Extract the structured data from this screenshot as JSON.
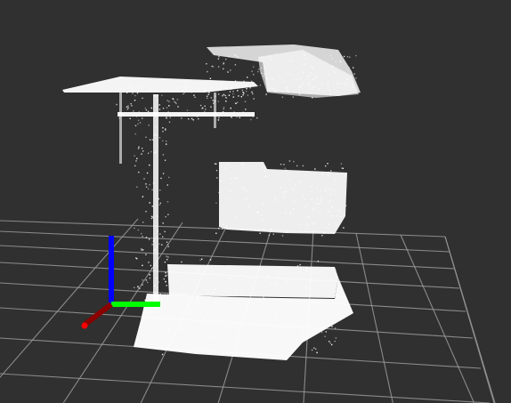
{
  "viewport": {
    "background_color": "#303030",
    "grid_color": "#9a9a9a",
    "point_color": "#ffffff"
  },
  "axes": {
    "x_color": "#ff0000",
    "y_color": "#00ff00",
    "z_color": "#0000ff"
  },
  "scene": {
    "type": "3d-point-cloud",
    "grid": true
  }
}
